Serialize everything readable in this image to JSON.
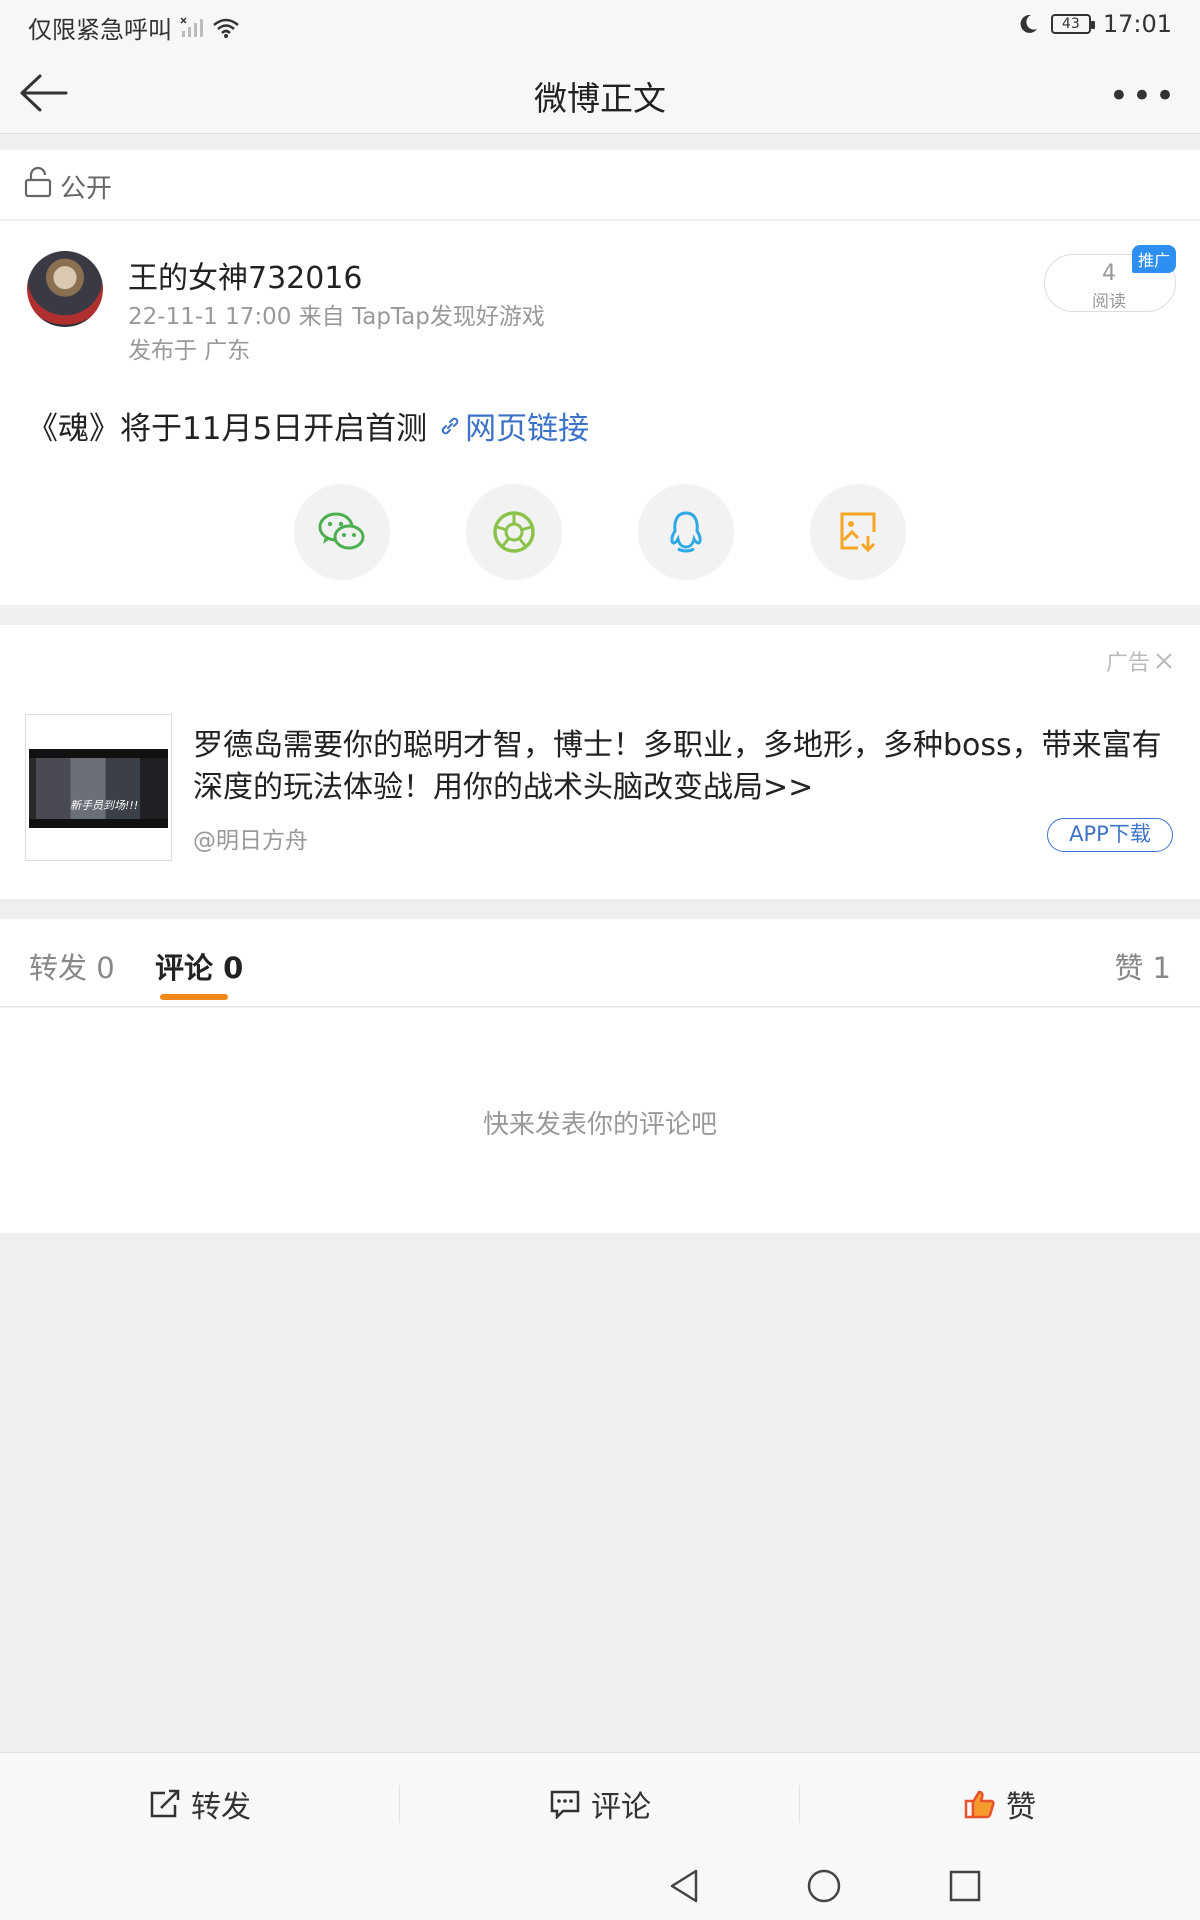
{
  "status_bar": {
    "carrier_text": "仅限紧急呼叫",
    "battery": "43",
    "time": "17:01"
  },
  "nav": {
    "title": "微博正文",
    "back_icon": "arrow-left-icon",
    "more_icon": "more-dots-icon"
  },
  "privacy": {
    "label": "公开",
    "icon": "unlock-icon"
  },
  "post": {
    "author": "王的女神732016",
    "meta": "22-11-1 17:00   来自 TapTap发现好游戏",
    "location": "发布于 广东",
    "read_count": "4",
    "read_label": "阅读",
    "promo_badge": "推广",
    "text": "《魂》将于11月5日开启首测",
    "link_text": "网页链接",
    "share_buttons": [
      "wechat-icon",
      "moments-icon",
      "qq-icon",
      "save-image-icon"
    ]
  },
  "ad": {
    "tag": "广告",
    "text": "罗德岛需要你的聪明才智，博士！多职业，多地形，多种boss，带来富有深度的玩法体验！用你的战术头脑改变战局>>",
    "source": "@明日方舟",
    "button": "APP下载",
    "thumb_caption": "新手员到场!!!"
  },
  "tabs": {
    "repost": "转发 0",
    "comment": "评论 0",
    "like": "赞 1",
    "active": "comment"
  },
  "comments": {
    "empty_text": "快来发表你的评论吧"
  },
  "toolbar": {
    "repost": "转发",
    "comment": "评论",
    "like": "赞"
  },
  "colors": {
    "link": "#3c73c8",
    "accent": "#f28a1a",
    "badge": "#2d8ff0"
  }
}
